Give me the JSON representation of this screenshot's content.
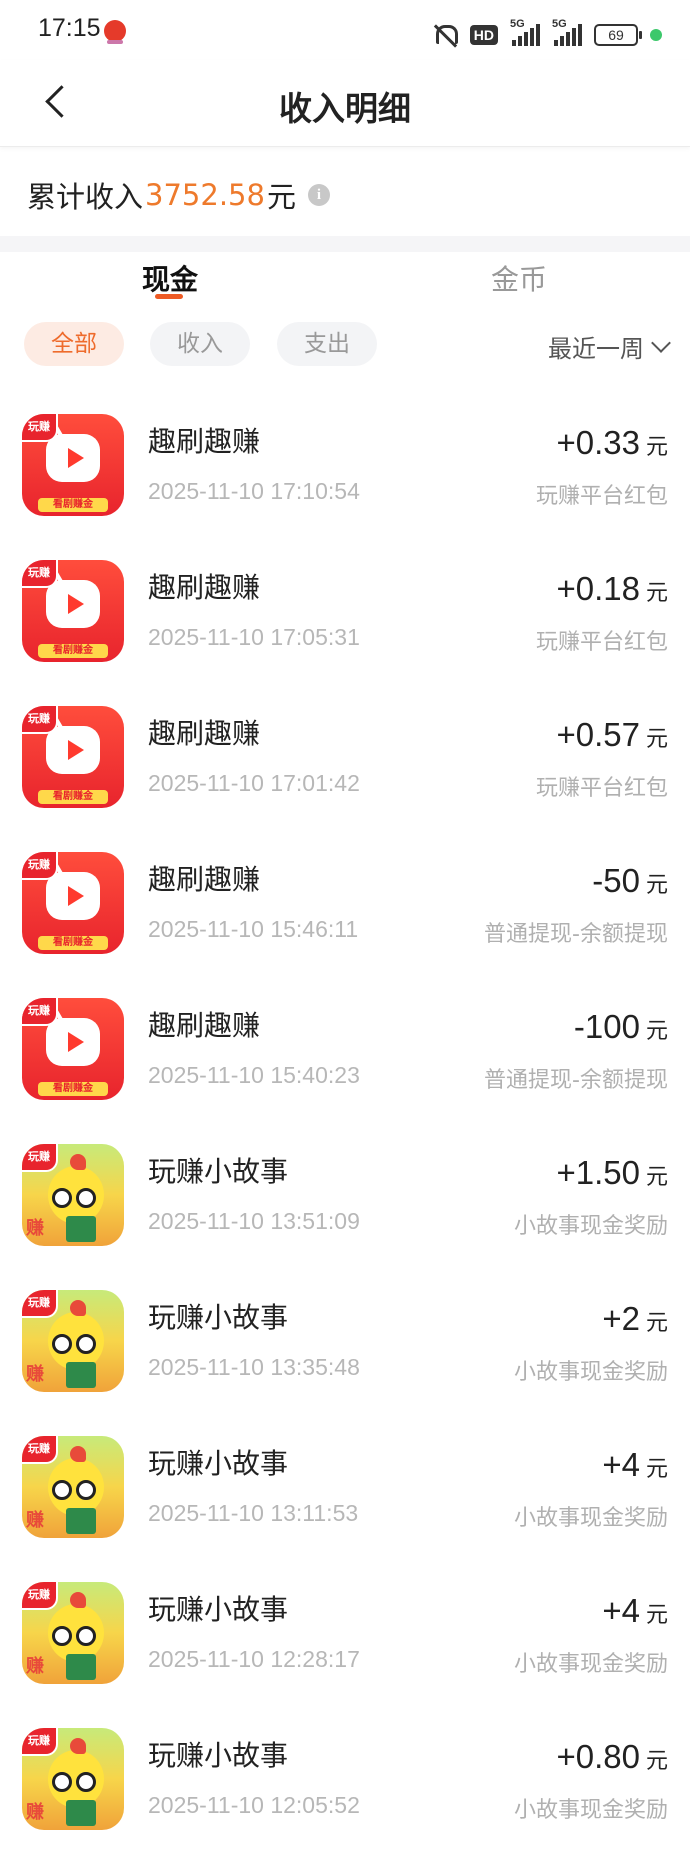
{
  "status_bar": {
    "time": "17:15",
    "hd": "HD",
    "battery": "69",
    "network_1": "5G",
    "network_2": "5G"
  },
  "header": {
    "title": "收入明细"
  },
  "summary": {
    "label": "累计收入",
    "amount": "3752.58",
    "unit": "元",
    "info_icon": "i"
  },
  "tabs": [
    {
      "label": "现金",
      "active": true
    },
    {
      "label": "金币",
      "active": false
    }
  ],
  "filters": [
    {
      "label": "全部",
      "active": true
    },
    {
      "label": "收入",
      "active": false
    },
    {
      "label": "支出",
      "active": false
    }
  ],
  "period": {
    "label": "最近一周"
  },
  "colors": {
    "accent": "#ee7a2c",
    "active_chip_bg": "#fdebe3",
    "tab_indicator": "#ee5a24"
  },
  "icon_texts": {
    "shua_banner": "看剧赚金",
    "badge": "玩赚",
    "story_mark": "赚"
  },
  "transactions": [
    {
      "app": "趣刷趣赚",
      "icon": "qushua-app-icon",
      "time": "2025-11-10 17:10:54",
      "amount": "+0.33",
      "unit": "元",
      "desc": "玩赚平台红包"
    },
    {
      "app": "趣刷趣赚",
      "icon": "qushua-app-icon",
      "time": "2025-11-10 17:05:31",
      "amount": "+0.18",
      "unit": "元",
      "desc": "玩赚平台红包"
    },
    {
      "app": "趣刷趣赚",
      "icon": "qushua-app-icon",
      "time": "2025-11-10 17:01:42",
      "amount": "+0.57",
      "unit": "元",
      "desc": "玩赚平台红包"
    },
    {
      "app": "趣刷趣赚",
      "icon": "qushua-app-icon",
      "time": "2025-11-10 15:46:11",
      "amount": "-50",
      "unit": "元",
      "desc": "普通提现-余额提现"
    },
    {
      "app": "趣刷趣赚",
      "icon": "qushua-app-icon",
      "time": "2025-11-10 15:40:23",
      "amount": "-100",
      "unit": "元",
      "desc": "普通提现-余额提现"
    },
    {
      "app": "玩赚小故事",
      "icon": "story-app-icon",
      "time": "2025-11-10 13:51:09",
      "amount": "+1.50",
      "unit": "元",
      "desc": "小故事现金奖励"
    },
    {
      "app": "玩赚小故事",
      "icon": "story-app-icon",
      "time": "2025-11-10 13:35:48",
      "amount": "+2",
      "unit": "元",
      "desc": "小故事现金奖励"
    },
    {
      "app": "玩赚小故事",
      "icon": "story-app-icon",
      "time": "2025-11-10 13:11:53",
      "amount": "+4",
      "unit": "元",
      "desc": "小故事现金奖励"
    },
    {
      "app": "玩赚小故事",
      "icon": "story-app-icon",
      "time": "2025-11-10 12:28:17",
      "amount": "+4",
      "unit": "元",
      "desc": "小故事现金奖励"
    },
    {
      "app": "玩赚小故事",
      "icon": "story-app-icon",
      "time": "2025-11-10 12:05:52",
      "amount": "+0.80",
      "unit": "元",
      "desc": "小故事现金奖励"
    }
  ]
}
